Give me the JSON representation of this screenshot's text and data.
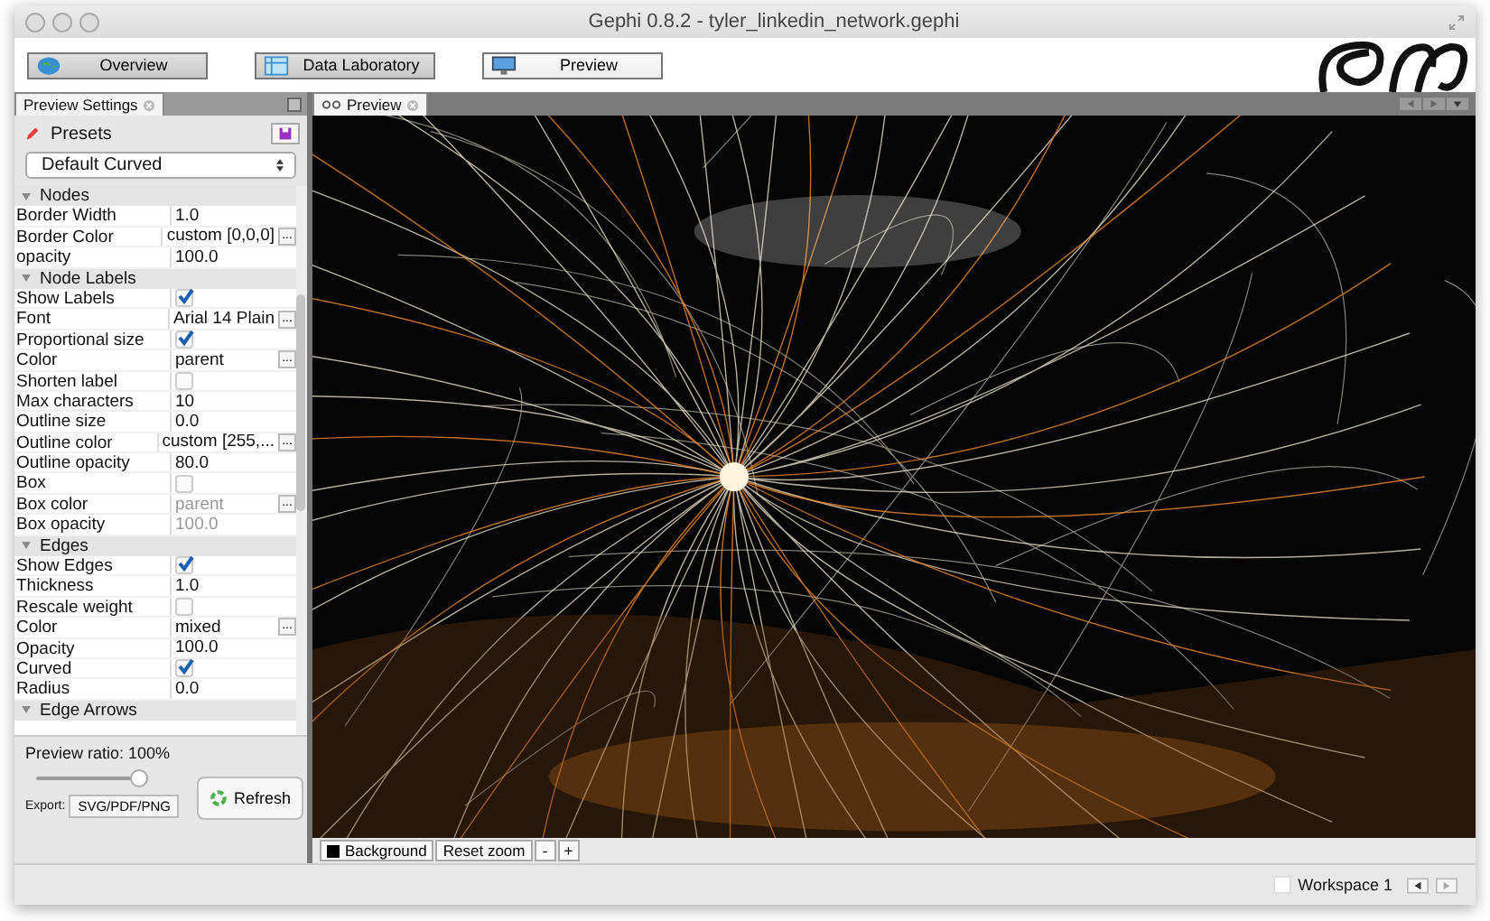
{
  "window": {
    "title": "Gephi 0.8.2 - tyler_linkedin_network.gephi"
  },
  "modes": [
    {
      "label": "Overview",
      "selected": false
    },
    {
      "label": "Data Laboratory",
      "selected": false
    },
    {
      "label": "Preview",
      "selected": true
    }
  ],
  "panel_tabs": [
    {
      "label": "Preview Settings",
      "selected": true
    }
  ],
  "preview_tabs": [
    {
      "label": "Preview",
      "selected": true
    }
  ],
  "presets": {
    "label": "Presets",
    "selected_preset": "Default Curved"
  },
  "properties": [
    {
      "kind": "section",
      "label": "Nodes"
    },
    {
      "kind": "text",
      "label": "Border Width",
      "value": "1.0",
      "disabled": false
    },
    {
      "kind": "text",
      "label": "Border Color",
      "value": "custom [0,0,0]",
      "button": "...",
      "disabled": false
    },
    {
      "kind": "text",
      "label": "opacity",
      "value": "100.0",
      "disabled": false
    },
    {
      "kind": "section",
      "label": "Node Labels"
    },
    {
      "kind": "checkbox",
      "label": "Show Labels",
      "checked": true,
      "disabled": false
    },
    {
      "kind": "text",
      "label": "Font",
      "value": "Arial 14 Plain",
      "button": "...",
      "disabled": false
    },
    {
      "kind": "checkbox",
      "label": "Proportional size",
      "checked": true,
      "disabled": false
    },
    {
      "kind": "text",
      "label": "Color",
      "value": "parent",
      "button": "...",
      "disabled": false
    },
    {
      "kind": "checkbox",
      "label": "Shorten label",
      "checked": false,
      "disabled": false
    },
    {
      "kind": "text",
      "label": "Max characters",
      "value": "10",
      "disabled": false
    },
    {
      "kind": "text",
      "label": "Outline size",
      "value": "0.0",
      "disabled": false
    },
    {
      "kind": "text",
      "label": "Outline color",
      "value": "custom [255,...",
      "button": "...",
      "disabled": false
    },
    {
      "kind": "text",
      "label": "Outline opacity",
      "value": "80.0",
      "disabled": false
    },
    {
      "kind": "checkbox",
      "label": "Box",
      "checked": false,
      "disabled": false
    },
    {
      "kind": "text",
      "label": "Box color",
      "value": "parent",
      "button": "...",
      "disabled": true
    },
    {
      "kind": "text",
      "label": "Box opacity",
      "value": "100.0",
      "disabled": true
    },
    {
      "kind": "section",
      "label": "Edges"
    },
    {
      "kind": "checkbox",
      "label": "Show Edges",
      "checked": true,
      "disabled": false
    },
    {
      "kind": "text",
      "label": "Thickness",
      "value": "1.0",
      "disabled": false
    },
    {
      "kind": "checkbox",
      "label": "Rescale weight",
      "checked": false,
      "disabled": false
    },
    {
      "kind": "text",
      "label": "Color",
      "value": "mixed",
      "button": "...",
      "disabled": false
    },
    {
      "kind": "text",
      "label": "Opacity",
      "value": "100.0",
      "disabled": false
    },
    {
      "kind": "checkbox",
      "label": "Curved",
      "checked": true,
      "disabled": false
    },
    {
      "kind": "text",
      "label": "Radius",
      "value": "0.0",
      "disabled": false
    },
    {
      "kind": "section",
      "label": "Edge Arrows"
    }
  ],
  "ratio": {
    "label": "Preview ratio: 100%",
    "level": 1.0
  },
  "refresh_button": "Refresh",
  "export": {
    "label": "Export:",
    "button": "SVG/PDF/PNG"
  },
  "preview_toolbar": {
    "background_button": "Background",
    "reset_zoom": "Reset zoom",
    "zoom_out": "-",
    "zoom_in": "+"
  },
  "status_bar": {
    "workspace": "Workspace 1"
  }
}
